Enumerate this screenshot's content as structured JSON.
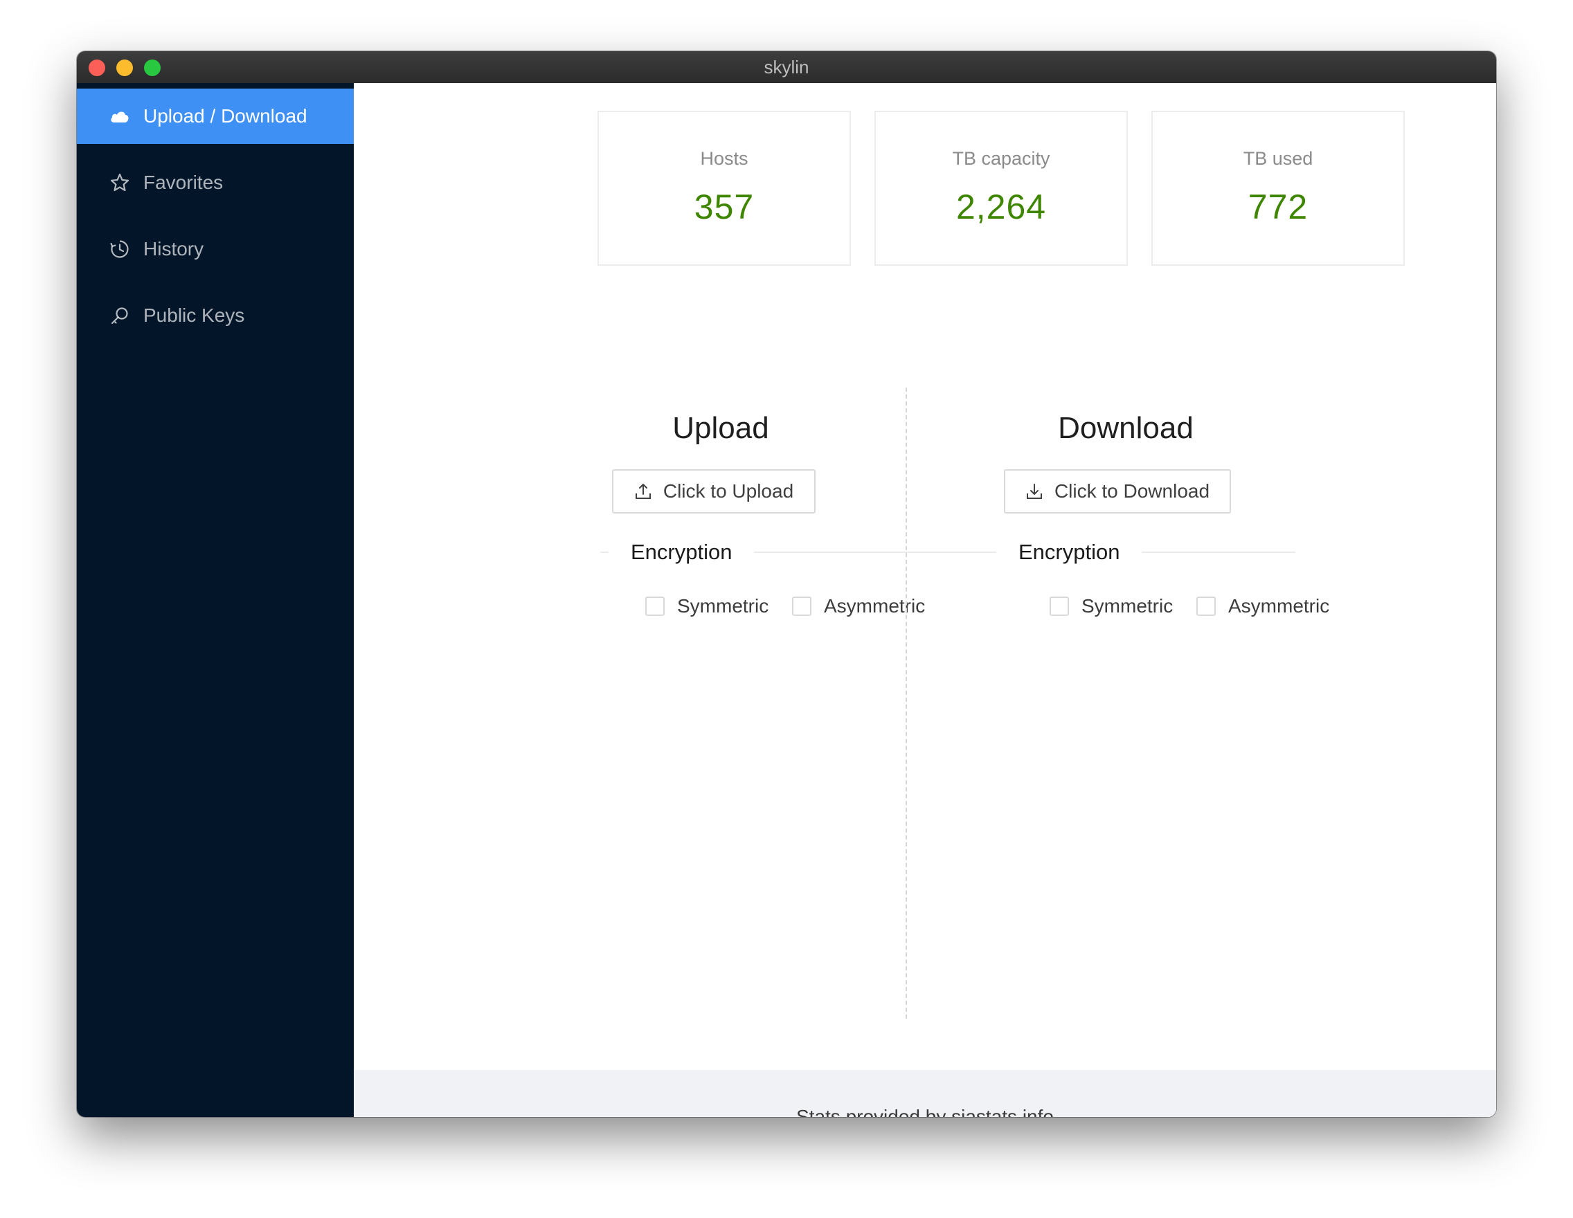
{
  "window": {
    "title": "skylin"
  },
  "sidebar": {
    "items": [
      {
        "label": "Upload / Download",
        "icon": "cloud-icon",
        "active": true
      },
      {
        "label": "Favorites",
        "icon": "star-icon",
        "active": false
      },
      {
        "label": "History",
        "icon": "clock-icon",
        "active": false
      },
      {
        "label": "Public Keys",
        "icon": "key-icon",
        "active": false
      }
    ]
  },
  "stats": [
    {
      "label": "Hosts",
      "value": "357"
    },
    {
      "label": "TB capacity",
      "value": "2,264"
    },
    {
      "label": "TB used",
      "value": "772"
    }
  ],
  "upload": {
    "title": "Upload",
    "button_label": "Click to Upload",
    "encryption_label": "Encryption",
    "options": [
      {
        "label": "Symmetric",
        "checked": false
      },
      {
        "label": "Asymmetric",
        "checked": false
      }
    ]
  },
  "download": {
    "title": "Download",
    "button_label": "Click to Download",
    "encryption_label": "Encryption",
    "options": [
      {
        "label": "Symmetric",
        "checked": false
      },
      {
        "label": "Asymmetric",
        "checked": false
      }
    ]
  },
  "footer": {
    "text": "Stats provided by siastats.info"
  },
  "colors": {
    "sidebar_bg": "#021529",
    "active_item": "#3e90f5",
    "stat_value": "#3f8600",
    "footer_bg": "#f0f2f5"
  }
}
